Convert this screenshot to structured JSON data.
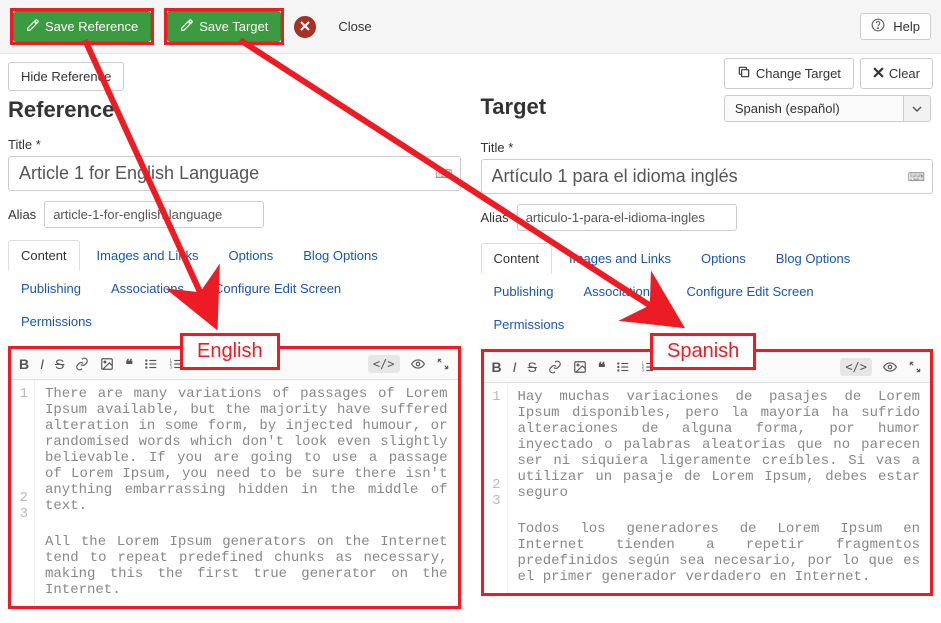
{
  "toolbar": {
    "save_reference": "Save Reference",
    "save_target": "Save Target",
    "close": "Close",
    "help": "Help"
  },
  "hide_reference": "Hide Reference",
  "reference": {
    "heading": "Reference",
    "title_label": "Title *",
    "title_value": "Article 1 for English Language",
    "alias_label": "Alias",
    "alias_value": "article-1-for-english-language",
    "editor_lines": {
      "p1": "There are many variations of passages of Lorem Ipsum available, but the majority have suffered alteration in some form, by injected humour, or randomised words which don't look even slightly believable. If you are going to use a passage of Lorem Ipsum, you need to be sure there isn't anything embarrassing hidden in the middle of text.",
      "p2": "All the Lorem Ipsum generators on the Internet tend to repeat predefined chunks as necessary, making this the first true generator on the Internet."
    }
  },
  "target": {
    "heading": "Target",
    "change_target": "Change Target",
    "clear": "Clear",
    "language_select": "Spanish (español)",
    "title_label": "Title *",
    "title_value": "Artículo 1 para el idioma inglés",
    "alias_label": "Alias",
    "alias_value": "articulo-1-para-el-idioma-ingles",
    "editor_lines": {
      "p1": "Hay muchas variaciones de pasajes de Lorem Ipsum disponibles, pero la mayoría ha sufrido alteraciones de alguna forma, por humor inyectado o palabras aleatorias que no parecen ser ni siquiera ligeramente creíbles. Si vas a utilizar un pasaje de Lorem Ipsum, debes estar seguro",
      "p2": "Todos los generadores de Lorem Ipsum en Internet tienden a repetir fragmentos predefinidos según sea necesario, por lo que es el primer generador verdadero en Internet."
    }
  },
  "tabs": {
    "content": "Content",
    "images_links": "Images and Links",
    "options": "Options",
    "blog_options": "Blog Options",
    "publishing": "Publishing",
    "associations": "Associations",
    "configure_edit": "Configure Edit Screen",
    "permissions": "Permissions"
  },
  "line_numbers": {
    "n1": "1",
    "n2": "2",
    "n3": "3"
  },
  "annotations": {
    "english": "English",
    "spanish": "Spanish"
  },
  "colors": {
    "annotation_red": "#ed1c24",
    "button_green": "#3c9a40",
    "link_blue": "#1a55ad"
  }
}
